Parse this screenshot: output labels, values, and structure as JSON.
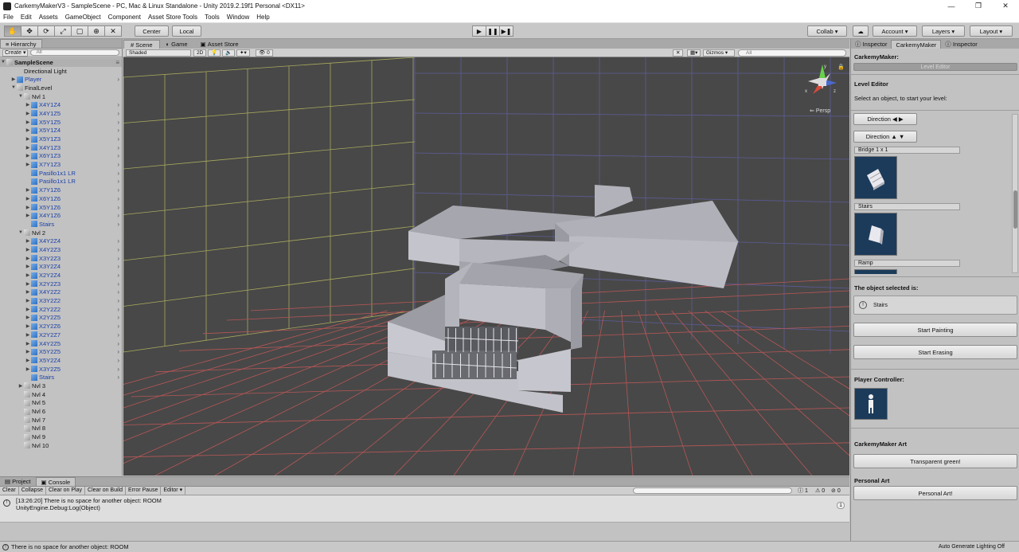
{
  "window": {
    "title": "CarkemyMakerV3 - SampleScene - PC, Mac & Linux Standalone - Unity 2019.2.19f1 Personal <DX11>",
    "controls": {
      "minimize": "—",
      "maximize": "❐",
      "close": "✕"
    }
  },
  "menu": [
    "File",
    "Edit",
    "Assets",
    "GameObject",
    "Component",
    "Asset Store Tools",
    "Tools",
    "Window",
    "Help"
  ],
  "toolbar": {
    "tools": [
      "✋",
      "✥",
      "⟳",
      "⤢",
      "▢",
      "⊕",
      "✕"
    ],
    "pivot": "Center",
    "space": "Local",
    "play": "▶",
    "pause": "❚❚",
    "step": "▶❚",
    "collab": "Collab ▾",
    "cloud": "☁",
    "account": "Account",
    "layers": "Layers",
    "layout": "Layout"
  },
  "hierarchy": {
    "tab": "Hierarchy",
    "create": "Create ▾",
    "search_placeholder": "All",
    "scene": "SampleScene",
    "rows": [
      {
        "label": "Directional Light",
        "indent": 2,
        "arrow": "",
        "icon": "none",
        "color": "black"
      },
      {
        "label": "Player",
        "indent": 1,
        "arrow": "▶",
        "icon": "blue",
        "color": "blue",
        "chev": true
      },
      {
        "label": "FinalLevel",
        "indent": 1,
        "arrow": "▼",
        "icon": "grey",
        "color": "black"
      },
      {
        "label": "Nvl 1",
        "indent": 2,
        "arrow": "▼",
        "icon": "grey",
        "color": "black"
      },
      {
        "label": "X4Y1Z4",
        "indent": 3,
        "arrow": "▶",
        "icon": "blue",
        "color": "blue",
        "chev": true
      },
      {
        "label": "X4Y1Z5",
        "indent": 3,
        "arrow": "▶",
        "icon": "blue",
        "color": "blue",
        "chev": true
      },
      {
        "label": "X5Y1Z5",
        "indent": 3,
        "arrow": "▶",
        "icon": "blue",
        "color": "blue",
        "chev": true
      },
      {
        "label": "X5Y1Z4",
        "indent": 3,
        "arrow": "▶",
        "icon": "blue",
        "color": "blue",
        "chev": true
      },
      {
        "label": "X5Y1Z3",
        "indent": 3,
        "arrow": "▶",
        "icon": "blue",
        "color": "blue",
        "chev": true
      },
      {
        "label": "X4Y1Z3",
        "indent": 3,
        "arrow": "▶",
        "icon": "blue",
        "color": "blue",
        "chev": true
      },
      {
        "label": "X6Y1Z3",
        "indent": 3,
        "arrow": "▶",
        "icon": "blue",
        "color": "blue",
        "chev": true
      },
      {
        "label": "X7Y1Z3",
        "indent": 3,
        "arrow": "▶",
        "icon": "blue",
        "color": "blue",
        "chev": true
      },
      {
        "label": "Pasillo1x1 LR",
        "indent": 3,
        "arrow": "",
        "icon": "blue",
        "color": "blue",
        "chev": true
      },
      {
        "label": "Pasillo1x1 LR",
        "indent": 3,
        "arrow": "",
        "icon": "blue",
        "color": "blue",
        "chev": true
      },
      {
        "label": "X7Y1Z6",
        "indent": 3,
        "arrow": "▶",
        "icon": "blue",
        "color": "blue",
        "chev": true
      },
      {
        "label": "X6Y1Z6",
        "indent": 3,
        "arrow": "▶",
        "icon": "blue",
        "color": "blue",
        "chev": true
      },
      {
        "label": "X5Y1Z6",
        "indent": 3,
        "arrow": "▶",
        "icon": "blue",
        "color": "blue",
        "chev": true
      },
      {
        "label": "X4Y1Z6",
        "indent": 3,
        "arrow": "▶",
        "icon": "blue",
        "color": "blue",
        "chev": true
      },
      {
        "label": "Stairs",
        "indent": 3,
        "arrow": "",
        "icon": "blue",
        "color": "blue",
        "chev": true
      },
      {
        "label": "Nvl 2",
        "indent": 2,
        "arrow": "▼",
        "icon": "grey",
        "color": "black"
      },
      {
        "label": "X4Y2Z4",
        "indent": 3,
        "arrow": "▶",
        "icon": "blue",
        "color": "blue",
        "chev": true
      },
      {
        "label": "X4Y2Z3",
        "indent": 3,
        "arrow": "▶",
        "icon": "blue",
        "color": "blue",
        "chev": true
      },
      {
        "label": "X3Y2Z3",
        "indent": 3,
        "arrow": "▶",
        "icon": "blue",
        "color": "blue",
        "chev": true
      },
      {
        "label": "X3Y2Z4",
        "indent": 3,
        "arrow": "▶",
        "icon": "blue",
        "color": "blue",
        "chev": true
      },
      {
        "label": "X2Y2Z4",
        "indent": 3,
        "arrow": "▶",
        "icon": "blue",
        "color": "blue",
        "chev": true
      },
      {
        "label": "X2Y2Z3",
        "indent": 3,
        "arrow": "▶",
        "icon": "blue",
        "color": "blue",
        "chev": true
      },
      {
        "label": "X4Y2Z2",
        "indent": 3,
        "arrow": "▶",
        "icon": "blue",
        "color": "blue",
        "chev": true
      },
      {
        "label": "X3Y2Z2",
        "indent": 3,
        "arrow": "▶",
        "icon": "blue",
        "color": "blue",
        "chev": true
      },
      {
        "label": "X2Y2Z2",
        "indent": 3,
        "arrow": "▶",
        "icon": "blue",
        "color": "blue",
        "chev": true
      },
      {
        "label": "X2Y2Z5",
        "indent": 3,
        "arrow": "▶",
        "icon": "blue",
        "color": "blue",
        "chev": true
      },
      {
        "label": "X2Y2Z6",
        "indent": 3,
        "arrow": "▶",
        "icon": "blue",
        "color": "blue",
        "chev": true
      },
      {
        "label": "X2Y2Z7",
        "indent": 3,
        "arrow": "▶",
        "icon": "blue",
        "color": "blue",
        "chev": true
      },
      {
        "label": "X4Y2Z5",
        "indent": 3,
        "arrow": "▶",
        "icon": "blue",
        "color": "blue",
        "chev": true
      },
      {
        "label": "X5Y2Z5",
        "indent": 3,
        "arrow": "▶",
        "icon": "blue",
        "color": "blue",
        "chev": true
      },
      {
        "label": "X5Y2Z4",
        "indent": 3,
        "arrow": "▶",
        "icon": "blue",
        "color": "blue",
        "chev": true
      },
      {
        "label": "X3Y2Z5",
        "indent": 3,
        "arrow": "▶",
        "icon": "blue",
        "color": "blue",
        "chev": true
      },
      {
        "label": "Stairs",
        "indent": 3,
        "arrow": "",
        "icon": "blue",
        "color": "blue",
        "chev": true
      },
      {
        "label": "Nvl 3",
        "indent": 2,
        "arrow": "▶",
        "icon": "grey",
        "color": "black"
      },
      {
        "label": "Nvl 4",
        "indent": 2,
        "arrow": "",
        "icon": "grey",
        "color": "black"
      },
      {
        "label": "Nvl 5",
        "indent": 2,
        "arrow": "",
        "icon": "grey",
        "color": "black"
      },
      {
        "label": "Nvl 6",
        "indent": 2,
        "arrow": "",
        "icon": "grey",
        "color": "black"
      },
      {
        "label": "Nvl 7",
        "indent": 2,
        "arrow": "",
        "icon": "grey",
        "color": "black"
      },
      {
        "label": "Nvl 8",
        "indent": 2,
        "arrow": "",
        "icon": "grey",
        "color": "black"
      },
      {
        "label": "Nvl 9",
        "indent": 2,
        "arrow": "",
        "icon": "grey",
        "color": "black"
      },
      {
        "label": "Nvl 10",
        "indent": 2,
        "arrow": "",
        "icon": "grey",
        "color": "black"
      }
    ]
  },
  "scene_view": {
    "tabs": [
      "Scene",
      "Game",
      "Asset Store"
    ],
    "shading": "Shaded",
    "mode_2d": "2D",
    "gizmos": "Gizmos ▾",
    "search_placeholder": "All",
    "fx_count": "0",
    "persp_label": "Persp",
    "axis_labels": {
      "y": "y",
      "x": "x",
      "z": "z"
    },
    "colors": {
      "background": "#484848",
      "grid_back": "#6a6aa8",
      "grid_left": "#b8b86a",
      "grid_floor": "#c85a5a",
      "mesh": "#a8a8b0"
    }
  },
  "console": {
    "tabs": [
      "Project",
      "Console"
    ],
    "buttons": [
      "Clear",
      "Collapse",
      "Clear on Play",
      "Clear on Build",
      "Error Pause",
      "Editor ▾"
    ],
    "counts": {
      "log": "1",
      "warn": "0",
      "error": "0"
    },
    "entries": [
      {
        "line1": "[13:26:20] There is no space for another object: ROOM",
        "line2": "UnityEngine.Debug:Log(Object)",
        "count": "1"
      }
    ]
  },
  "statusbar": {
    "message": "There is no space for another object: ROOM",
    "right": "Auto Generate Lighting Off"
  },
  "inspector": {
    "tabs": [
      "Inspector",
      "CarkemyMaker",
      "Inspector"
    ],
    "title": "CarkemyMaker:",
    "level_editor_button": "Level Editor",
    "level_editor_heading": "Level Editor",
    "level_editor_hint": "Select an object, to start your level:",
    "direction_lr": "Direction ◀ ▶",
    "direction_ud": "Direction ▲ ▼",
    "prefabs": [
      "Bridge 1 x 1",
      "Stairs",
      "Ramp"
    ],
    "selected_heading": "The object selected is:",
    "selected_value": "Stairs",
    "start_painting": "Start Painting",
    "start_erasing": "Start Erasing",
    "player_controller": "Player Controller:",
    "art_heading": "CarkemyMaker Art",
    "art_button": "Transparent green!",
    "personal_heading": "Personal Art",
    "personal_button": "Personal Art!"
  }
}
